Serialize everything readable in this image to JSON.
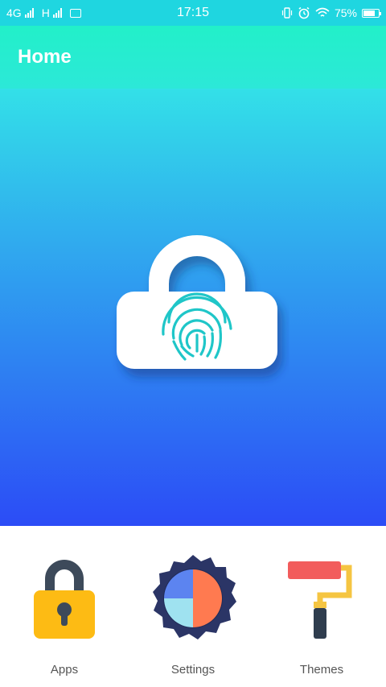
{
  "status_bar": {
    "network_1": "4G",
    "network_2": "H",
    "time": "17:15",
    "battery_percent": "75%",
    "battery_level": 0.75
  },
  "header": {
    "title": "Home"
  },
  "hero": {
    "icon": "fingerprint-lock-icon"
  },
  "bottom_nav": {
    "items": [
      {
        "label": "Apps",
        "icon": "padlock-icon"
      },
      {
        "label": "Settings",
        "icon": "pie-gear-icon"
      },
      {
        "label": "Themes",
        "icon": "paint-roller-icon"
      }
    ]
  },
  "colors": {
    "status_bar": "#1fd6e0",
    "top_bar": "#22f0c9",
    "gradient_top": "#33e0e8",
    "gradient_bottom": "#2c4cf6",
    "label_text": "#555555"
  }
}
